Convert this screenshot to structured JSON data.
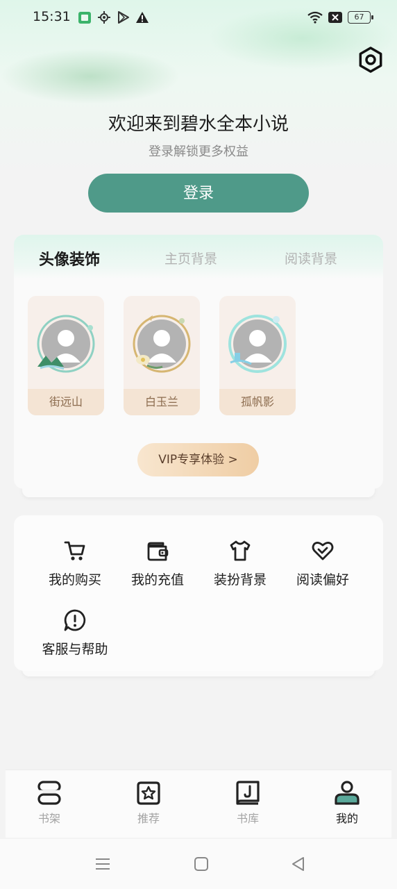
{
  "status_bar": {
    "time": "15:31",
    "battery": "67"
  },
  "header": {
    "welcome": "欢迎来到碧水全本小说",
    "subtitle": "登录解锁更多权益",
    "login_label": "登录"
  },
  "decoration": {
    "tabs": [
      {
        "label": "头像装饰",
        "active": true
      },
      {
        "label": "主页背景",
        "active": false
      },
      {
        "label": "阅读背景",
        "active": false
      }
    ],
    "avatars": [
      {
        "name": "街远山"
      },
      {
        "name": "白玉兰"
      },
      {
        "name": "孤帆影"
      }
    ],
    "vip_label": "VIP专享体验 >"
  },
  "menu": {
    "items": [
      {
        "label": "我的购买",
        "icon": "cart-icon"
      },
      {
        "label": "我的充值",
        "icon": "wallet-icon"
      },
      {
        "label": "装扮背景",
        "icon": "shirt-icon"
      },
      {
        "label": "阅读偏好",
        "icon": "heart-icon"
      },
      {
        "label": "客服与帮助",
        "icon": "alert-circle-icon"
      }
    ]
  },
  "bottom_nav": {
    "items": [
      {
        "label": "书架",
        "icon": "bookshelf-icon",
        "active": false
      },
      {
        "label": "推荐",
        "icon": "star-badge-icon",
        "active": false
      },
      {
        "label": "书库",
        "icon": "book-music-icon",
        "active": false
      },
      {
        "label": "我的",
        "icon": "person-icon",
        "active": true
      }
    ]
  },
  "colors": {
    "accent": "#4f9a89",
    "vip_gold": "#efcda4",
    "avatar_label_bg": "#f4e4d4"
  }
}
